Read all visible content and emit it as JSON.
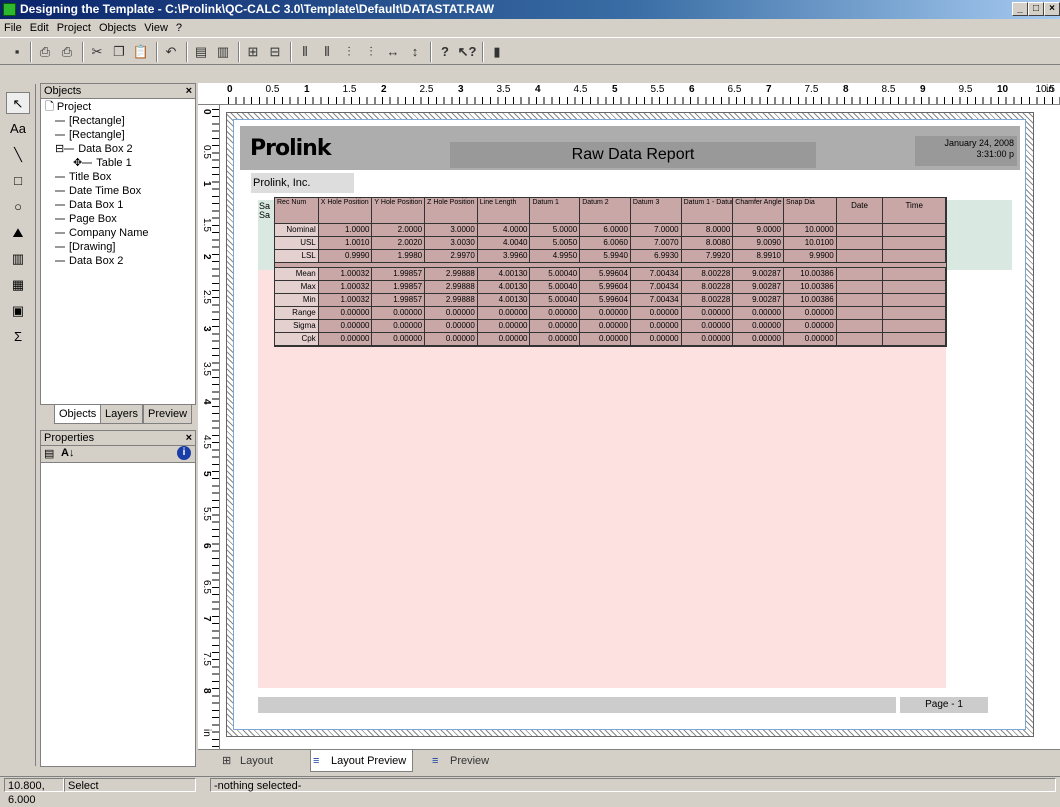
{
  "window": {
    "title": "Designing the Template - C:\\Prolink\\QC-CALC 3.0\\Template\\Default\\DATASTAT.RAW"
  },
  "menu": [
    "File",
    "Edit",
    "Project",
    "Objects",
    "View",
    "?"
  ],
  "objects_panel": {
    "title": "Objects",
    "tree": [
      {
        "label": "Project",
        "level": 0
      },
      {
        "label": "[Rectangle]",
        "level": 1
      },
      {
        "label": "[Rectangle]",
        "level": 1
      },
      {
        "label": "Data Box 2",
        "level": 1
      },
      {
        "label": "Table 1",
        "level": 2
      },
      {
        "label": "Title Box",
        "level": 1
      },
      {
        "label": "Date Time Box",
        "level": 1
      },
      {
        "label": "Data Box 1",
        "level": 1
      },
      {
        "label": "Page Box",
        "level": 1
      },
      {
        "label": "Company Name",
        "level": 1
      },
      {
        "label": "[Drawing]",
        "level": 1
      },
      {
        "label": "Data Box 2",
        "level": 1
      }
    ],
    "tabs": [
      "Objects",
      "Layers",
      "Preview"
    ]
  },
  "properties_panel": {
    "title": "Properties"
  },
  "ruler": {
    "h": [
      "0",
      "0.5",
      "1",
      "1.5",
      "2",
      "2.5",
      "3",
      "3.5",
      "4",
      "4.5",
      "5",
      "5.5",
      "6",
      "6.5",
      "7",
      "7.5",
      "8",
      "8.5",
      "9",
      "9.5",
      "10",
      "10.5",
      "in"
    ],
    "v": [
      "0",
      "0.5",
      "1",
      "1.5",
      "2",
      "2.5",
      "3",
      "3.5",
      "4",
      "4.5",
      "5",
      "5.5",
      "6",
      "6.5",
      "7",
      "7.5",
      "8",
      "in"
    ]
  },
  "report": {
    "logo": "Prolink",
    "title": "Raw Data Report",
    "date": "January 24, 2008",
    "time": "3:31:00 p",
    "company": "Prolink, Inc.",
    "sa1": "Sa",
    "sa2": "Sa",
    "page": "Page - 1",
    "columns": [
      "Rec Num",
      "X Hole Position",
      "Y Hole Position",
      "Z Hole Position",
      "Line Length",
      "Datum 1",
      "Datum 2",
      "Datum 3",
      "Datum 1 - Datum2",
      "Chamfer Angle",
      "Snap Dia",
      "Date",
      "Time"
    ],
    "spec_rows": [
      {
        "label": "Nominal",
        "values": [
          "1.0000",
          "2.0000",
          "3.0000",
          "4.0000",
          "5.0000",
          "6.0000",
          "7.0000",
          "8.0000",
          "9.0000",
          "10.0000"
        ]
      },
      {
        "label": "USL",
        "values": [
          "1.0010",
          "2.0020",
          "3.0030",
          "4.0040",
          "5.0050",
          "6.0060",
          "7.0070",
          "8.0080",
          "9.0090",
          "10.0100"
        ]
      },
      {
        "label": "LSL",
        "values": [
          "0.9990",
          "1.9980",
          "2.9970",
          "3.9960",
          "4.9950",
          "5.9940",
          "6.9930",
          "7.9920",
          "8.9910",
          "9.9900"
        ]
      }
    ],
    "stat_rows": [
      {
        "label": "Mean",
        "values": [
          "1.00032",
          "1.99857",
          "2.99888",
          "4.00130",
          "5.00040",
          "5.99604",
          "7.00434",
          "8.00228",
          "9.00287",
          "10.00386"
        ]
      },
      {
        "label": "Max",
        "values": [
          "1.00032",
          "1.99857",
          "2.99888",
          "4.00130",
          "5.00040",
          "5.99604",
          "7.00434",
          "8.00228",
          "9.00287",
          "10.00386"
        ]
      },
      {
        "label": "Min",
        "values": [
          "1.00032",
          "1.99857",
          "2.99888",
          "4.00130",
          "5.00040",
          "5.99604",
          "7.00434",
          "8.00228",
          "9.00287",
          "10.00386"
        ]
      },
      {
        "label": "Range",
        "values": [
          "0.00000",
          "0.00000",
          "0.00000",
          "0.00000",
          "0.00000",
          "0.00000",
          "0.00000",
          "0.00000",
          "0.00000",
          "0.00000"
        ]
      },
      {
        "label": "Sigma",
        "values": [
          "0.00000",
          "0.00000",
          "0.00000",
          "0.00000",
          "0.00000",
          "0.00000",
          "0.00000",
          "0.00000",
          "0.00000",
          "0.00000"
        ]
      },
      {
        "label": "Cpk",
        "values": [
          "0.00000",
          "0.00000",
          "0.00000",
          "0.00000",
          "0.00000",
          "0.00000",
          "0.00000",
          "0.00000",
          "0.00000",
          "0.00000"
        ]
      }
    ]
  },
  "bottom_tabs": [
    "Layout",
    "Layout Preview",
    "Preview"
  ],
  "status": {
    "coords": "10.800, 6.000",
    "mode": "Select",
    "selection": "-nothing selected-"
  }
}
